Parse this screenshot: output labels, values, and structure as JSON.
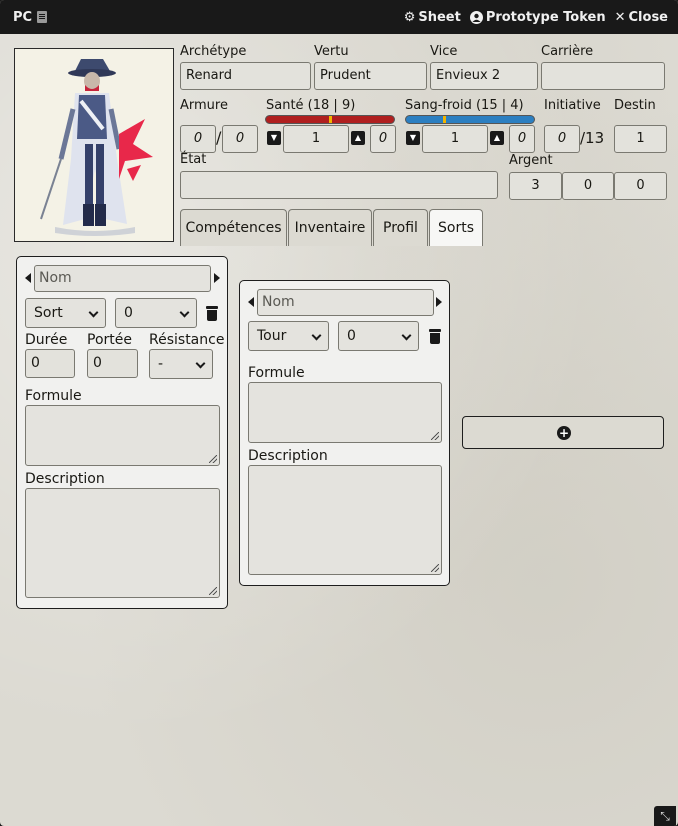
{
  "window": {
    "title": "PC",
    "controls": {
      "sheet": "Sheet",
      "prototype_token": "Prototype Token",
      "close": "Close"
    }
  },
  "identity": {
    "archetype": {
      "label": "Archétype",
      "value": "Renard"
    },
    "vertu": {
      "label": "Vertu",
      "value": "Prudent"
    },
    "vice": {
      "label": "Vice",
      "value": "Envieux 2"
    },
    "carriere": {
      "label": "Carrière",
      "value": ""
    }
  },
  "stats": {
    "armure": {
      "label": "Armure",
      "values": [
        "0",
        "0"
      ],
      "sep": "/"
    },
    "sante": {
      "label": "Santé (18 | 9)",
      "value": "1",
      "extra": "0",
      "bar_color": "#b01f1f",
      "level": 0.5
    },
    "sangfroid": {
      "label": "Sang-froid (15 | 4)",
      "value": "1",
      "extra": "0",
      "bar_color": "#2c7fc1",
      "level": 0.3
    },
    "initiative": {
      "label": "Initiative",
      "value": "0",
      "max": "/13"
    },
    "destin": {
      "label": "Destin",
      "value": "1"
    },
    "etat": {
      "label": "État",
      "value": ""
    },
    "argent": {
      "label": "Argent",
      "values": [
        "3",
        "0",
        "0"
      ]
    }
  },
  "tabs": [
    "Compétences",
    "Inventaire",
    "Profil",
    "Sorts"
  ],
  "active_tab": "Sorts",
  "spells": [
    {
      "name_placeholder": "Nom",
      "type": "Sort",
      "level": "0",
      "duree": {
        "label": "Durée",
        "value": "0"
      },
      "portee": {
        "label": "Portée",
        "value": "0"
      },
      "resistance": {
        "label": "Résistance",
        "value": "-"
      },
      "formule_label": "Formule",
      "description_label": "Description"
    },
    {
      "name_placeholder": "Nom",
      "type": "Tour",
      "level": "0",
      "formule_label": "Formule",
      "description_label": "Description"
    }
  ],
  "icons": {
    "sheet": "gear-icon",
    "token": "user-circle-icon",
    "close": "x-icon",
    "add": "plus-circle-icon",
    "delete": "trash-icon",
    "expand": "expand-icon"
  }
}
